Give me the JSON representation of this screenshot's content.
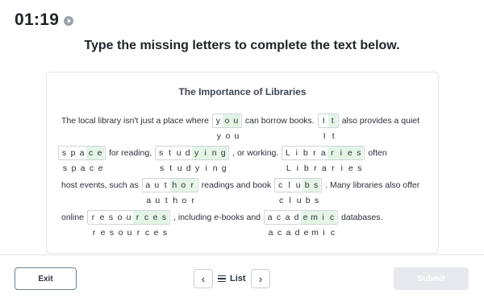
{
  "timer": {
    "time": "01:19",
    "icon": "play-icon"
  },
  "instruction": "Type the missing letters to complete the text below.",
  "passage": {
    "title": "The Importance of Libraries",
    "lines": [
      [
        {
          "t": "text",
          "v": "The local library isn't just a place where"
        },
        {
          "t": "word",
          "given": "",
          "letters": [
            "y",
            "o",
            "u"
          ],
          "filled": [
            false,
            true,
            true
          ]
        },
        {
          "t": "text",
          "v": "can borrow books."
        },
        {
          "t": "word",
          "given": "",
          "letters": [
            "I",
            "t"
          ],
          "filled": [
            false,
            true
          ]
        },
        {
          "t": "text",
          "v": "also provides a quiet"
        }
      ],
      [
        {
          "t": "word",
          "given": "",
          "letters": [
            "s",
            "p",
            "a",
            "c",
            "e"
          ],
          "filled": [
            false,
            false,
            false,
            true,
            true
          ]
        },
        {
          "t": "text",
          "v": "for reading,"
        },
        {
          "t": "word",
          "given": "",
          "letters": [
            "s",
            "t",
            "u",
            "d",
            "y",
            "i",
            "n",
            "g"
          ],
          "filled": [
            false,
            false,
            false,
            false,
            true,
            true,
            true,
            true
          ]
        },
        {
          "t": "text",
          "v": ", or working."
        },
        {
          "t": "word",
          "given": "",
          "letters": [
            "L",
            "i",
            "b",
            "r",
            "a",
            "r",
            "i",
            "e",
            "s"
          ],
          "filled": [
            false,
            false,
            false,
            false,
            false,
            true,
            true,
            true,
            true
          ]
        },
        {
          "t": "text",
          "v": "often"
        }
      ],
      [
        {
          "t": "text",
          "v": "host events, such as"
        },
        {
          "t": "word",
          "given": "",
          "letters": [
            "a",
            "u",
            "t",
            "h",
            "o",
            "r"
          ],
          "filled": [
            false,
            false,
            false,
            true,
            true,
            true
          ]
        },
        {
          "t": "text",
          "v": "readings and book"
        },
        {
          "t": "word",
          "given": "",
          "letters": [
            "c",
            "l",
            "u",
            "b",
            "s"
          ],
          "filled": [
            false,
            false,
            false,
            true,
            true
          ]
        },
        {
          "t": "text",
          "v": ". Many libraries also offer"
        }
      ],
      [
        {
          "t": "text",
          "v": "online"
        },
        {
          "t": "word",
          "given": "",
          "letters": [
            "r",
            "e",
            "s",
            "o",
            "u",
            "r",
            "c",
            "e",
            "s"
          ],
          "filled": [
            false,
            false,
            false,
            false,
            false,
            true,
            true,
            true,
            true
          ]
        },
        {
          "t": "text",
          "v": ", including e-books and"
        },
        {
          "t": "word",
          "given": "",
          "letters": [
            "a",
            "c",
            "a",
            "d",
            "e",
            "m",
            "i",
            "c"
          ],
          "filled": [
            false,
            false,
            false,
            false,
            true,
            true,
            true,
            true
          ]
        },
        {
          "t": "text",
          "v": "databases."
        }
      ]
    ]
  },
  "footer": {
    "exit_label": "Exit",
    "prev_icon": "chevron-left-icon",
    "list_icon": "list-icon",
    "list_label": "List",
    "next_icon": "chevron-right-icon",
    "submit_label": "Submit"
  }
}
